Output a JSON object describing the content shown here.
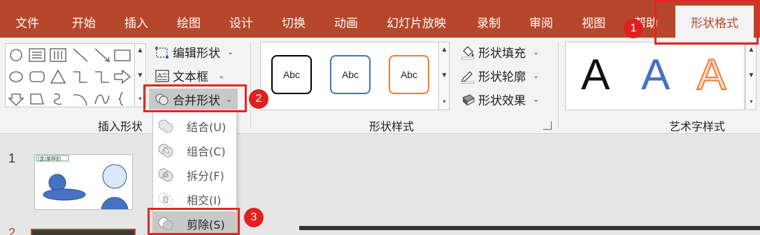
{
  "tabs": [
    {
      "label": "文件"
    },
    {
      "label": "开始"
    },
    {
      "label": "插入"
    },
    {
      "label": "绘图"
    },
    {
      "label": "设计"
    },
    {
      "label": "切换"
    },
    {
      "label": "动画"
    },
    {
      "label": "幻灯片放映"
    },
    {
      "label": "录制"
    },
    {
      "label": "审阅"
    },
    {
      "label": "视图"
    },
    {
      "label": "帮助"
    },
    {
      "label": "形状格式"
    }
  ],
  "ribbon": {
    "insert_shapes": {
      "edit_shape": "编辑形状",
      "text_box": "文本框",
      "merge_shapes": "合并形状",
      "label": "插入形状"
    },
    "shape_styles": {
      "samples": [
        "Abc",
        "Abc",
        "Abc"
      ],
      "sample_colors": [
        "#000000",
        "#4472c4",
        "#ed7d31"
      ],
      "fill": "形状填充",
      "outline": "形状轮廓",
      "effects": "形状效果",
      "label": "形状样式"
    },
    "wordart": {
      "samples": [
        "A",
        "A",
        "A"
      ],
      "label": "艺术字样式"
    }
  },
  "merge_menu": {
    "items": [
      {
        "label": "结合(U)"
      },
      {
        "label": "组合(C)"
      },
      {
        "label": "拆分(F)"
      },
      {
        "label": "相交(I)"
      },
      {
        "label": "剪除(S)"
      }
    ],
    "selected_index": 4
  },
  "callouts": [
    "1",
    "2",
    "3"
  ],
  "slides": {
    "numbers": [
      "1",
      "2"
    ],
    "thumb1_text": "(定/单样的"
  },
  "colors": {
    "accent": "#b7472a",
    "callout": "#e02020",
    "shape_fill": "#4472c4",
    "shape_fill_light": "#dae8f8"
  }
}
